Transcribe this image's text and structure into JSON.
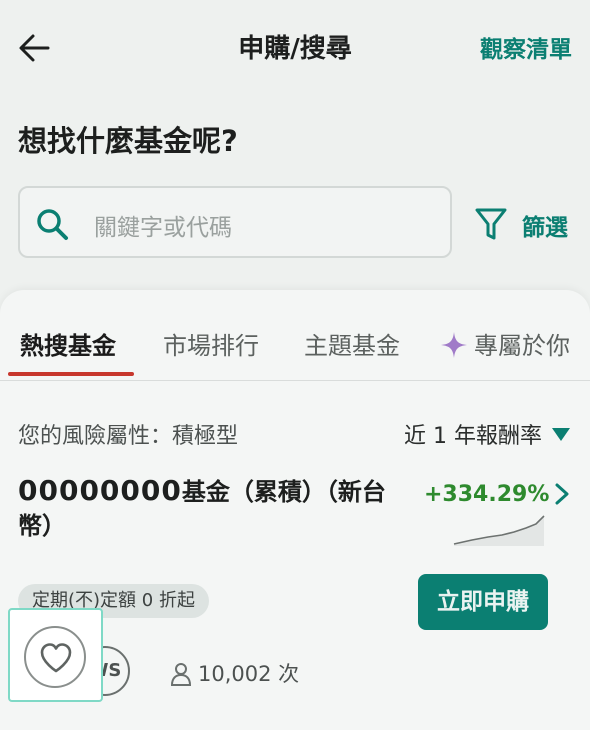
{
  "header": {
    "back_icon": "arrow-left-icon",
    "title": "申購/搜尋",
    "watchlist_label": "觀察清單"
  },
  "question": "想找什麼基金呢?",
  "search": {
    "icon": "search-icon",
    "placeholder": "關鍵字或代碼"
  },
  "filter": {
    "icon": "filter-icon",
    "label": "篩選"
  },
  "tabs": [
    {
      "label": "熱搜基金",
      "active": true
    },
    {
      "label": "市場排行",
      "active": false
    },
    {
      "label": "主題基金",
      "active": false
    },
    {
      "label": "專屬於你",
      "active": false,
      "icon": "sparkle-icon"
    }
  ],
  "risk_profile": "您的風險屬性：積極型",
  "period_selector": "近 1 年報酬率",
  "fund": {
    "code": "00000000",
    "name_suffix": "基金（累積）（新台幣）",
    "return": "+334.29%",
    "tag": "定期(不)定額 0 折起",
    "buy_label": "立即申購",
    "badge_text": "WS",
    "views": "10,002 次"
  },
  "favorite_icon": "heart-icon",
  "colors": {
    "accent": "#0b7f72",
    "tab_underline": "#c7372d",
    "positive": "#2e8a2e",
    "highlight_border": "#7fd9c6"
  }
}
